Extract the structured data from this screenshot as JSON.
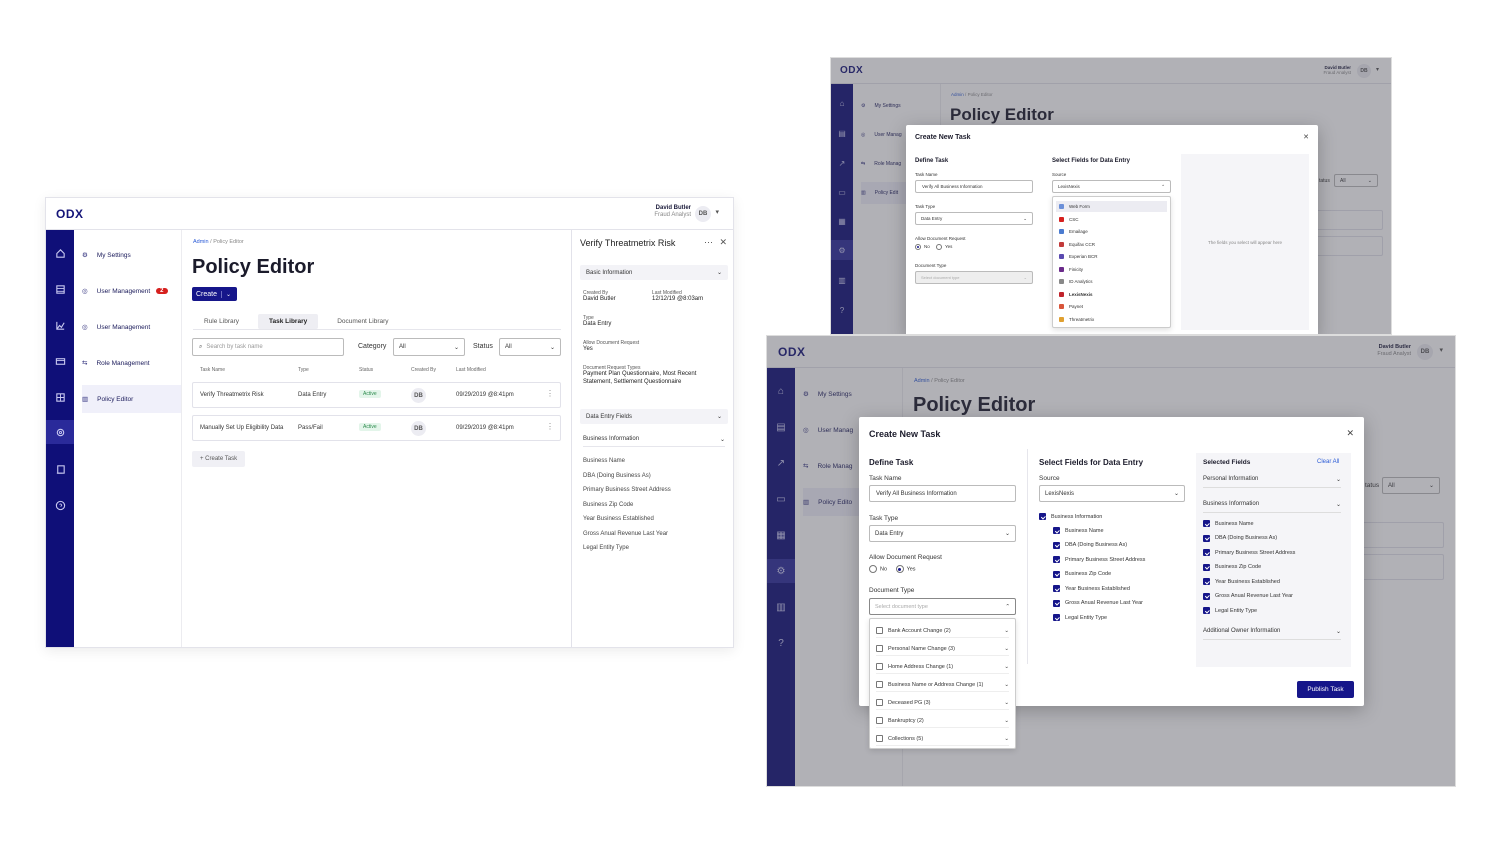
{
  "colors": {
    "brand": "#0f0f78",
    "accent": "#16168a",
    "active": "#2b8a4c",
    "badge": "#d6201e"
  },
  "app": {
    "logo": "ODX",
    "user_name": "David Butler",
    "user_role": "Fraud Analyst",
    "user_initials": "DB"
  },
  "nav": {
    "items": [
      {
        "label": "My Settings",
        "icon": "gear-icon"
      },
      {
        "label": "User Management",
        "icon": "user-icon",
        "badge": "2"
      },
      {
        "label": "User Management",
        "icon": "user-icon"
      },
      {
        "label": "Role Management",
        "icon": "role-icon"
      },
      {
        "label": "Policy Editor",
        "icon": "document-icon"
      }
    ],
    "short_items": [
      "My Settings",
      "User Manag",
      "Role Manag",
      "Policy Edit"
    ],
    "short_items_2": [
      "My Settings",
      "User Manag",
      "Role Manag",
      "Policy Edito"
    ]
  },
  "rail_icons": [
    "home-icon",
    "table-icon",
    "chart-icon",
    "card-icon",
    "grid-icon",
    "settings-icon",
    "policy-icon",
    "help-icon"
  ],
  "breadcrumb": {
    "root": "Admin",
    "sep": "/",
    "current": "Policy Editor"
  },
  "page": {
    "title": "Policy Editor",
    "create_label": "Create"
  },
  "tabs": [
    "Rule Library",
    "Task Library",
    "Document Library"
  ],
  "filters": {
    "search_placeholder": "Search by task name",
    "category_label": "Category",
    "category_value": "All",
    "status_label": "Status",
    "status_value": "All"
  },
  "table": {
    "headers": [
      "Task Name",
      "Type",
      "Status",
      "Created By",
      "Last Modified"
    ],
    "rows": [
      {
        "name": "Verify Threatmetrix Risk",
        "type": "Data Entry",
        "status": "Active",
        "by": "DB",
        "modified": "09/29/2019 @8:41pm"
      },
      {
        "name": "Manually Set Up Eligibility Data",
        "type": "Pass/Fail",
        "status": "Active",
        "by": "DB",
        "modified": "09/29/2019 @8:41pm"
      }
    ],
    "add_label": "+ Create Task"
  },
  "detail": {
    "title": "Verify Threatmetrix Risk",
    "section_basic": "Basic Information",
    "created_by_label": "Created By",
    "created_by": "David Butler",
    "last_modified_label": "Last Modified",
    "last_modified": "12/12/19 @8:03am",
    "type_label": "Type",
    "type": "Data Entry",
    "allow_label": "Allow Document Request",
    "allow": "Yes",
    "doc_types_label": "Document Request Types",
    "doc_types": "Payment Plan Questionnaire, Most Recent Statement, Settlement Questionnaire",
    "section_fields": "Data Entry Fields",
    "section_business": "Business Information",
    "fields": [
      "Business Name",
      "DBA (Doing Business As)",
      "Primary Business Street Address",
      "Business Zip Code",
      "Year Business Established",
      "Gross Anual Revenue Last Year",
      "Legal Entity Type"
    ]
  },
  "modal": {
    "title": "Create New Task",
    "define": "Define Task",
    "task_name_label": "Task Name",
    "task_name": "Verify All Business Information",
    "task_type_label": "Task Type",
    "task_type": "Data Entry",
    "allow_label": "Allow Document Request",
    "no": "No",
    "yes": "Yes",
    "doc_type_label": "Document Type",
    "doc_type_placeholder": "Select document type",
    "select_fields": "Select Fields for Data Entry",
    "source_label": "Source",
    "source": "LexisNexis",
    "placeholder_note": "The fields you select will appear here",
    "sources": [
      "Web Form",
      "CSC",
      "Emailage",
      "Equifax CCR",
      "Experian BCR",
      "Finicity",
      "ID Analytics",
      "LexisNexis",
      "Paynet",
      "Threatmetrix"
    ],
    "source_colors": [
      "#6b8fd8",
      "#d6201e",
      "#4a7bd0",
      "#c23a3a",
      "#5a4ab0",
      "#6a2a8a",
      "#888888",
      "#c0232b",
      "#d8553a",
      "#e0a030"
    ],
    "doc_options": [
      "Bank Account Change (2)",
      "Personal Name Change (3)",
      "Home Address Change (1)",
      "Business Name or Address Change (1)",
      "Deceased PG (3)",
      "Bankruptcy (2)",
      "Collections (5)"
    ],
    "group": "Business Information",
    "selected_title": "Selected Fields",
    "clear_all": "Clear All",
    "personal": "Personal Information",
    "business": "Business Information",
    "additional": "Additional Owner Information",
    "publish": "Publish Task"
  },
  "bg_filter": {
    "status_label": "tatus",
    "status_value": "All"
  }
}
